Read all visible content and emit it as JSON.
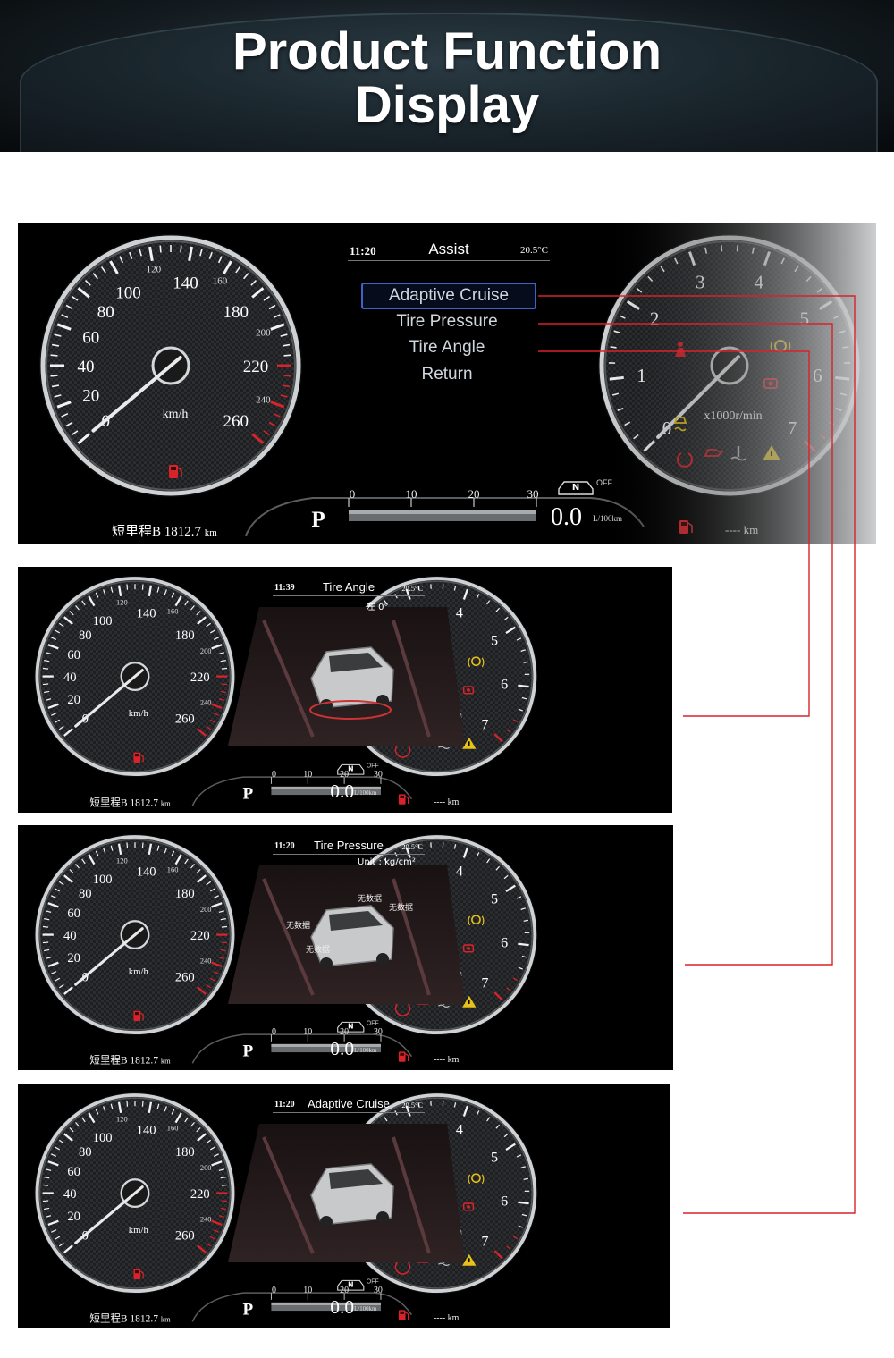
{
  "banner": {
    "title_line1": "Product Function",
    "title_line2": "Display"
  },
  "main_panel": {
    "time": "11:20",
    "title": "Assist",
    "temperature": "20.5°C",
    "menu": [
      "Adaptive Cruise",
      "Tire Pressure",
      "Tire Angle",
      "Return"
    ],
    "selected_index": 0
  },
  "speedometer": {
    "major_labels": [
      "0",
      "20",
      "40",
      "60",
      "80",
      "100",
      "140",
      "180",
      "220",
      "260"
    ],
    "minor_labels": [
      "120",
      "160",
      "200",
      "240"
    ],
    "unit": "km/h",
    "needle_value": 0
  },
  "tachometer": {
    "labels": [
      "0",
      "1",
      "2",
      "3",
      "4",
      "5",
      "6",
      "7"
    ],
    "unit": "x1000r/min",
    "needle_value": 0
  },
  "odometer": {
    "label": "短里程B",
    "value": "1812.7",
    "unit": "km"
  },
  "gear": "P",
  "fuel_scale": [
    "0",
    "10",
    "20",
    "30"
  ],
  "fuel_consumption": {
    "value": "0.0",
    "unit": "L/100km"
  },
  "range": {
    "value": "----",
    "unit": "km"
  },
  "off_label": "OFF",
  "n_label": "N",
  "sub_panels": [
    {
      "time": "11:39",
      "title": "Tire Angle",
      "temperature": "20.5°C",
      "extra": "左  0°"
    },
    {
      "time": "11:20",
      "title": "Tire Pressure",
      "temperature": "20.5°C",
      "extra": "Unit : kg/cm²",
      "tire_labels": [
        "无数据",
        "无数据",
        "无数据",
        "无数据"
      ]
    },
    {
      "time": "11:20",
      "title": "Adaptive Cruise",
      "temperature": "20.5°C",
      "extra": ""
    }
  ],
  "colors": {
    "accent_red": "#d8232a",
    "warning_yellow": "#e6c21a",
    "selection_blue": "#3c64c8"
  }
}
